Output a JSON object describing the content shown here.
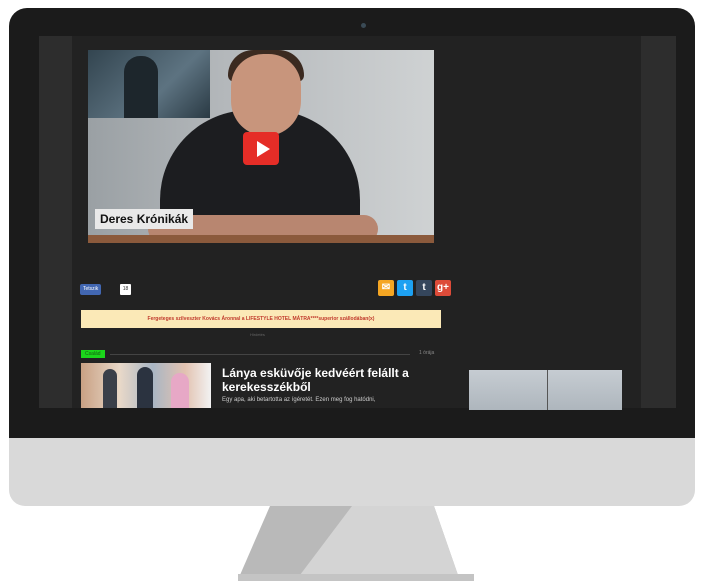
{
  "video": {
    "label": "Deres Krónikák",
    "play": "play-button"
  },
  "share": {
    "like_label": "Tetszik",
    "like_count": "18",
    "mail": "✉",
    "twitter": "t",
    "tumblr": "t",
    "gplus": "g+"
  },
  "promo": {
    "text": "Fergeteges szilveszter Kovács Áronnal a LIFESTYLE HOTEL MÁTRA****superior szállodában(x)",
    "tag": "Hirdetés"
  },
  "article": {
    "category": "Család",
    "time": "1 órája",
    "title": "Lánya esküvője kedvéért felállt a kerekesszékből",
    "excerpt": "Egy apa, aki betartotta az ígéretét. Ezen meg fog hatódni,"
  },
  "colors": {
    "accent_green": "#1bd61b",
    "play_red": "#e52d27",
    "promo_bg": "#fbe9b7"
  }
}
